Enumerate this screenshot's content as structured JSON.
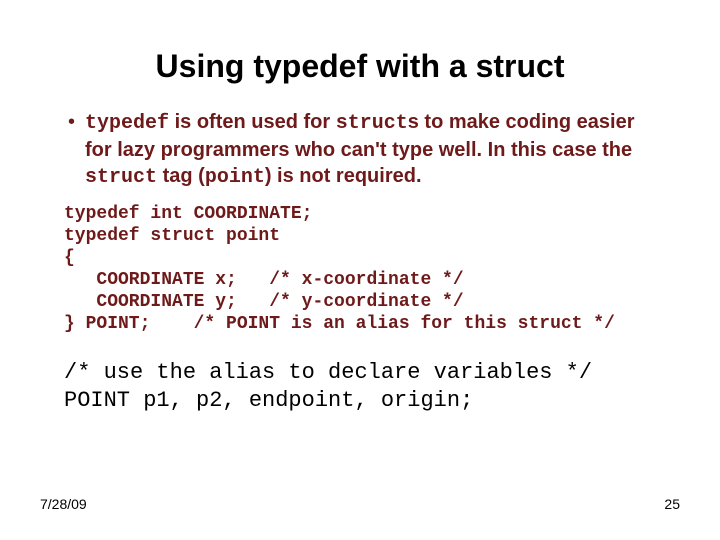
{
  "title": "Using typedef with a struct",
  "bullet": {
    "seg1": "typedef",
    "seg2": " is often used for ",
    "seg3": "struct",
    "seg4": "s to make coding easier for lazy programmers who can't type well. In this case the ",
    "seg5": "struct",
    "seg6": " tag (",
    "seg7": "point",
    "seg8": ") is not required."
  },
  "code1": "typedef int COORDINATE;\ntypedef struct point\n{\n   COORDINATE x;   /* x-coordinate */\n   COORDINATE y;   /* y-coordinate */\n} POINT;    /* POINT is an alias for this struct */",
  "code2": "/* use the alias to declare variables */\nPOINT p1, p2, endpoint, origin;",
  "footer": {
    "date": "7/28/09",
    "page": "25"
  }
}
